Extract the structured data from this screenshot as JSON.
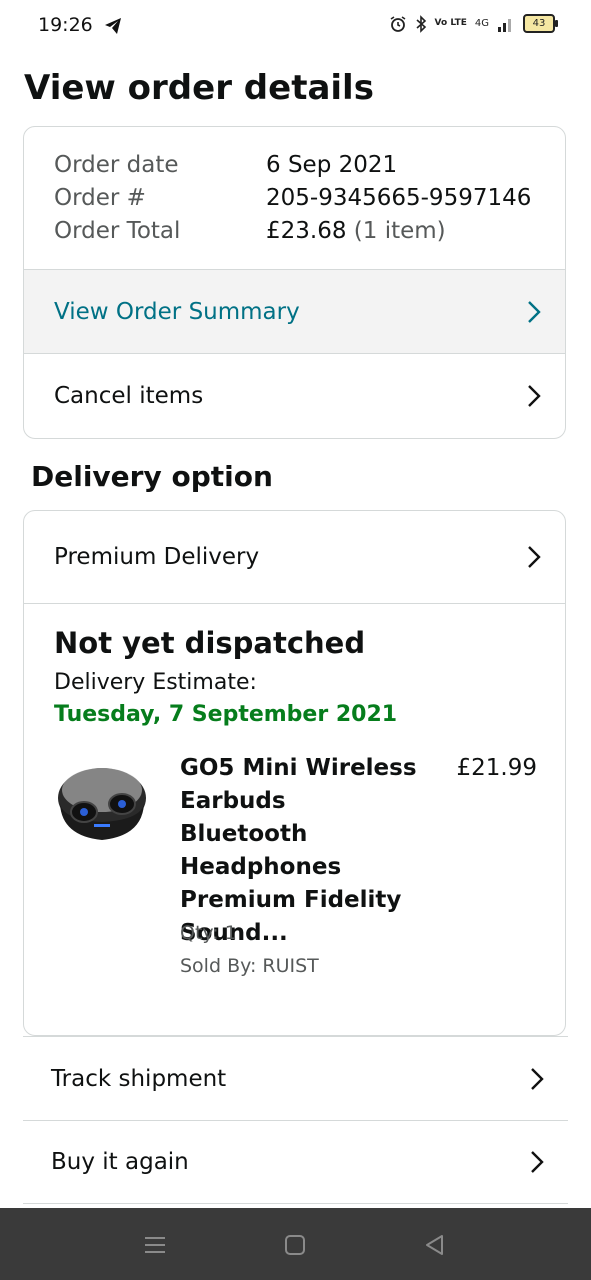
{
  "status_bar": {
    "time": "19:26",
    "network": "4G",
    "volte": "Vo LTE",
    "battery": "43"
  },
  "page": {
    "title": "View order details"
  },
  "order": {
    "date_label": "Order date",
    "date_value": "6 Sep 2021",
    "number_label": "Order #",
    "number_value": "205-9345665-9597146",
    "total_label": "Order Total",
    "total_value": "£23.68",
    "total_items": "(1 item)",
    "summary_link": "View Order Summary",
    "cancel_label": "Cancel items"
  },
  "delivery": {
    "section_title": "Delivery option",
    "option_label": "Premium Delivery",
    "status": "Not yet dispatched",
    "estimate_label": "Delivery Estimate:",
    "estimate_date": "Tuesday, 7 September 2021"
  },
  "product": {
    "title": "GO5 Mini Wireless Earbuds Bluetooth Headphones Premium Fidelity Sound...",
    "price": "£21.99",
    "qty": "Qty: 1",
    "seller": "Sold By: RUIST"
  },
  "actions": {
    "track": "Track shipment",
    "buy_again": "Buy it again"
  },
  "icons": {
    "chevron": "chevron-right-icon",
    "nav": [
      "menu-icon",
      "home-icon",
      "back-icon"
    ]
  },
  "colors": {
    "link": "#007185",
    "delivery_date": "#067d1c",
    "border": "#d5d9d9",
    "summary_bg": "#f3f3f3",
    "nav_bg": "#3a3a3a"
  }
}
